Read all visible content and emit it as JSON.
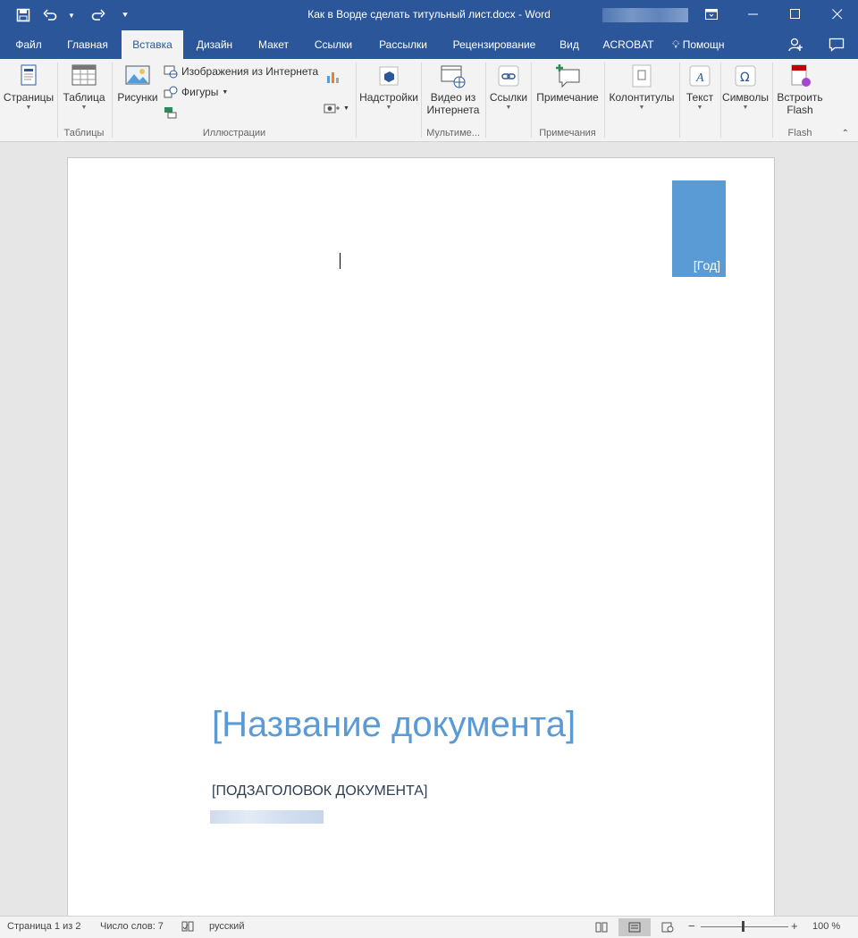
{
  "window": {
    "title": "Как в Ворде сделать титульный лист.docx - Word"
  },
  "tabs": {
    "file": "Файл",
    "home": "Главная",
    "insert": "Вставка",
    "design": "Дизайн",
    "layout": "Макет",
    "references": "Ссылки",
    "mailings": "Рассылки",
    "review": "Рецензирование",
    "view": "Вид",
    "acrobat": "ACROBAT",
    "tell_me": "Помощн"
  },
  "ribbon": {
    "pages": "Страницы",
    "table": "Таблица",
    "tables_group": "Таблицы",
    "pictures": "Рисунки",
    "online_pictures": "Изображения из Интернета",
    "shapes": "Фигуры",
    "illustrations_group": "Иллюстрации",
    "addins": "Надстройки",
    "online_video_line1": "Видео из",
    "online_video_line2": "Интернета",
    "media_group": "Мультиме...",
    "links": "Ссылки",
    "comment": "Примечание",
    "comments_group": "Примечания",
    "header_footer": "Колонтитулы",
    "text": "Текст",
    "symbols": "Символы",
    "flash_line1": "Встроить",
    "flash_line2": "Flash",
    "flash_group": "Flash"
  },
  "document": {
    "year": "[Год]",
    "title": "[Название документа]",
    "subtitle": "[ПОДЗАГОЛОВОК ДОКУМЕНТА]"
  },
  "status": {
    "page": "Страница 1 из 2",
    "words": "Число слов: 7",
    "language": "русский",
    "zoom": "100 %"
  },
  "colors": {
    "brand": "#2b579a",
    "accent": "#5b9bd5"
  }
}
